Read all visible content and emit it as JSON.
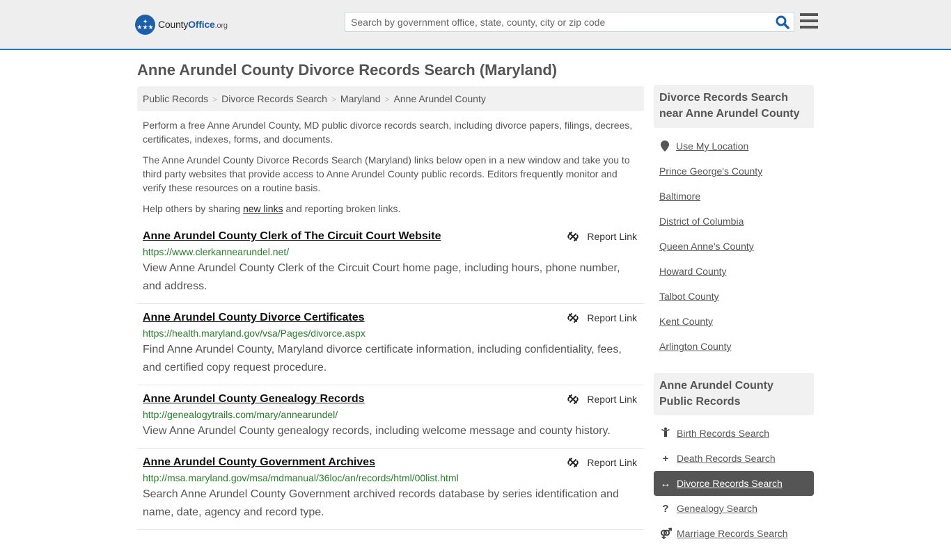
{
  "header": {
    "logo": {
      "name_part1": "County",
      "name_part2": "Office",
      "name_part3": ".org"
    },
    "search": {
      "placeholder": "Search by government office, state, county, city or zip code",
      "value": ""
    },
    "icons": {
      "search": "search-icon",
      "menu": "hamburger-menu-icon"
    }
  },
  "page": {
    "title": "Anne Arundel County Divorce Records Search (Maryland)"
  },
  "breadcrumb": [
    "Public Records",
    "Divorce Records Search",
    "Maryland",
    "Anne Arundel County"
  ],
  "intro": {
    "p1": "Perform a free Anne Arundel County, MD public divorce records search, including divorce papers, filings, decrees, certificates, indexes, forms, and documents.",
    "p2": "The Anne Arundel County Divorce Records Search (Maryland) links below open in a new window and take you to third party websites that provide access to Anne Arundel County public records. Editors frequently monitor and verify these resources on a routine basis.",
    "p3_before": "Help others by sharing ",
    "p3_link": "new links",
    "p3_after": " and reporting broken links."
  },
  "results": [
    {
      "title": "Anne Arundel County Clerk of The Circuit Court Website",
      "url": "https://www.clerkannearundel.net/",
      "description": "View Anne Arundel County Clerk of the Circuit Court home page, including hours, phone number, and address.",
      "report_label": "Report Link"
    },
    {
      "title": "Anne Arundel County Divorce Certificates",
      "url": "https://health.maryland.gov/vsa/Pages/divorce.aspx",
      "description": "Find Anne Arundel County, Maryland divorce certificate information, including confidentiality, fees, and certified copy request procedure.",
      "report_label": "Report Link"
    },
    {
      "title": "Anne Arundel County Genealogy Records",
      "url": "http://genealogytrails.com/mary/annearundel/",
      "description": "View Anne Arundel County genealogy records, including welcome message and county history.",
      "report_label": "Report Link"
    },
    {
      "title": "Anne Arundel County Government Archives",
      "url": "http://msa.maryland.gov/msa/mdmanual/36loc/an/records/html/00list.html",
      "description": "Search Anne Arundel County Government archived records database by series identification and name, date, agency and record type.",
      "report_label": "Report Link"
    }
  ],
  "sidebar": {
    "nearby": {
      "heading": "Divorce Records Search near Anne Arundel County",
      "use_location": "Use My Location",
      "links": [
        "Prince George's County",
        "Baltimore",
        "District of Columbia",
        "Queen Anne's County",
        "Howard County",
        "Talbot County",
        "Kent County",
        "Arlington County"
      ]
    },
    "public_records": {
      "heading": "Anne Arundel County Public Records",
      "items": [
        {
          "label": "Birth Records Search",
          "icon": "child-icon",
          "glyph": "🯅",
          "active": false
        },
        {
          "label": "Death Records Search",
          "icon": "plus-icon",
          "glyph": "+",
          "active": false
        },
        {
          "label": "Divorce Records Search",
          "icon": "arrows-horizontal-icon",
          "glyph": "↔",
          "active": true
        },
        {
          "label": "Genealogy Search",
          "icon": "question-icon",
          "glyph": "?",
          "active": false
        },
        {
          "label": "Marriage Records Search",
          "icon": "marriage-icon",
          "glyph": "⚤",
          "active": false
        }
      ]
    }
  },
  "colors": {
    "accent_blue": "#2f77b1",
    "logo_blue": "#1d5fa8",
    "url_green": "#2a7a2a",
    "active_bg": "#555555"
  }
}
